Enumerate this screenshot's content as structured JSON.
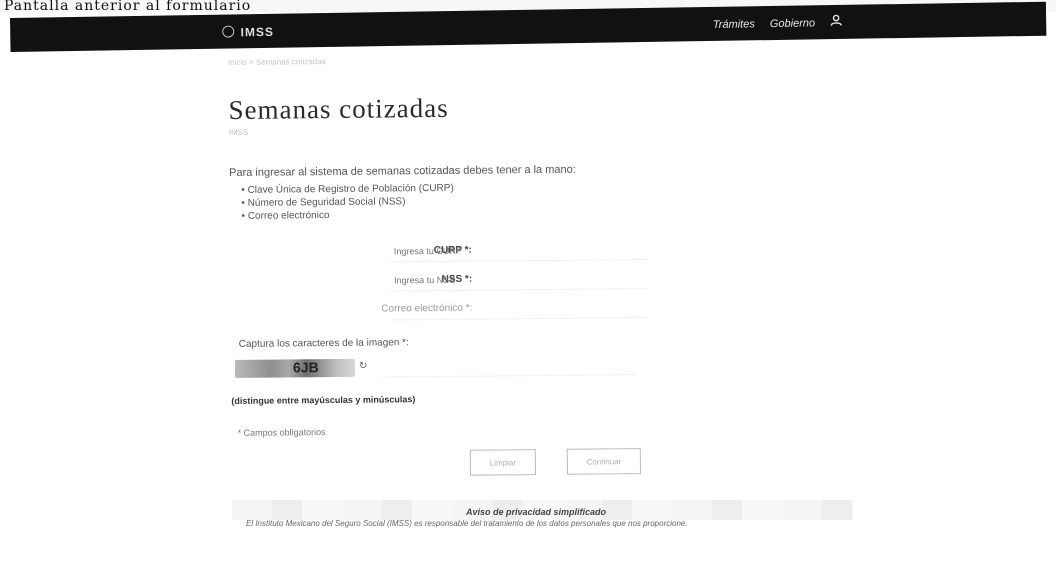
{
  "header_strip": {
    "text": "Pantalla anterior al formulario"
  },
  "navbar": {
    "brand": "IMSS",
    "links": [
      "Trámites",
      "Gobierno"
    ],
    "user_icon": "user-icon"
  },
  "breadcrumb": "Inicio > Semanas cotizadas",
  "page": {
    "title": "Semanas cotizadas",
    "subtitle": "IMSS"
  },
  "intro": "Para ingresar al sistema de semanas cotizadas debes tener a la mano:",
  "requirements": [
    "Clave Única de Registro de Población (CURP)",
    "Número de Seguridad Social (NSS)",
    "Correo electrónico"
  ],
  "form": {
    "curp": {
      "label": "CURP *:",
      "placeholder": "Ingresa tu CURP"
    },
    "nss": {
      "label": "NSS *:",
      "placeholder": "Ingresa tu NSS"
    },
    "email": {
      "label": "Correo electrónico *:",
      "placeholder": ""
    },
    "captcha_label": "Captura los caracteres de la imagen *:",
    "captcha_text": "6JB",
    "case_note": "(distingue entre mayúsculas y minúsculas)",
    "required_note": "* Campos obligatorios"
  },
  "buttons": {
    "clear": "Limpiar",
    "continue": "Continuar"
  },
  "privacy": {
    "title": "Aviso de privacidad simplificado",
    "text": "El Instituto Mexicano del Seguro Social (IMSS) es responsable del tratamiento de los datos personales que nos proporcione."
  }
}
